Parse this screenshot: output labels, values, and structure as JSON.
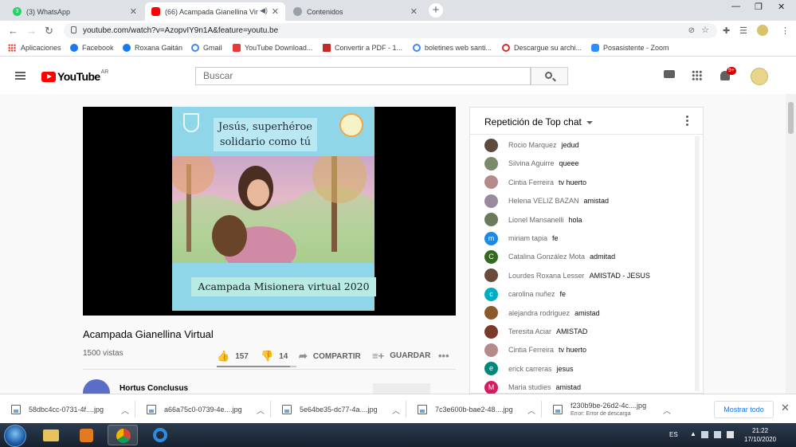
{
  "browser": {
    "tabs": [
      {
        "label": "(3) WhatsApp",
        "favicon_color": "#25d366",
        "favicon_text": "3"
      },
      {
        "label": "(66) Acampada Gianellina Vir",
        "favicon_color": "#ff0000",
        "favicon_text": ""
      },
      {
        "label": "Contenidos",
        "favicon_color": "#9aa0a6",
        "favicon_text": ""
      }
    ],
    "url": "youtube.com/watch?v=AzopvIY9n1A&feature=youtu.be",
    "bookmarks": [
      {
        "label": "Aplicaciones",
        "color": "#ea4335"
      },
      {
        "label": "Facebook",
        "color": "#1877f2"
      },
      {
        "label": "Roxana Gaitán",
        "color": "#1877f2"
      },
      {
        "label": "Gmail",
        "color": "#4285f4"
      },
      {
        "label": "YouTube Download...",
        "color": "#e53935"
      },
      {
        "label": "Convertir a PDF - 1...",
        "color": "#c62828"
      },
      {
        "label": "boletines web santi...",
        "color": "#4285f4"
      },
      {
        "label": "Descargue su archi...",
        "color": "#d32f2f"
      },
      {
        "label": "Posasistente - Zoom",
        "color": "#2d8cff"
      }
    ]
  },
  "youtube": {
    "logo_text": "YouTube",
    "region": "AR",
    "search_placeholder": "Buscar",
    "notifications": "9+",
    "video": {
      "title_overlay_line1": "Jesús, superhéroe",
      "title_overlay_line2": "solidario como tú",
      "caption": "Acampada Misionera virtual 2020",
      "title": "Acampada Gianellina Virtual",
      "views": "1500 vistas",
      "likes": "157",
      "dislikes": "14",
      "like_ratio": 0.918,
      "share_label": "COMPARTIR",
      "save_label": "GUARDAR",
      "channel": "Hortus Conclusus"
    },
    "chat": {
      "title": "Repetición de Top chat",
      "messages": [
        {
          "author": "Rocio Marquez",
          "text": "jedud",
          "avatar_color": "#5d4a3a",
          "initial": ""
        },
        {
          "author": "Silvina Aguirre",
          "text": "queee",
          "avatar_color": "#7a8a6a",
          "initial": ""
        },
        {
          "author": "Cintia Ferreira",
          "text": "tv huerto",
          "avatar_color": "#b58a8a",
          "initial": ""
        },
        {
          "author": "Helena VELIZ BAZAN",
          "text": "amistad",
          "avatar_color": "#9a8aa0",
          "initial": ""
        },
        {
          "author": "Lionel Mansanelli",
          "text": "hola",
          "avatar_color": "#6a7a5a",
          "initial": ""
        },
        {
          "author": "miriam tapia",
          "text": "fe",
          "avatar_color": "#1e88e5",
          "initial": "m"
        },
        {
          "author": "Catalina González Mota",
          "text": "admitad",
          "avatar_color": "#33691e",
          "initial": "C"
        },
        {
          "author": "Lourdes Roxana Lesser",
          "text": "AMISTAD - JESUS",
          "avatar_color": "#6a4a3a",
          "initial": ""
        },
        {
          "author": "carolina nuñez",
          "text": "fe",
          "avatar_color": "#00acc1",
          "initial": "c"
        },
        {
          "author": "alejandra rodriguez",
          "text": "amistad",
          "avatar_color": "#8a5a2a",
          "initial": ""
        },
        {
          "author": "Teresita Aciar",
          "text": "AMISTAD",
          "avatar_color": "#7a3a2a",
          "initial": ""
        },
        {
          "author": "Cintia Ferreira",
          "text": "tv huerto",
          "avatar_color": "#b58a8a",
          "initial": ""
        },
        {
          "author": "erick carreras",
          "text": "jesus",
          "avatar_color": "#00897b",
          "initial": "e"
        },
        {
          "author": "Maria studies",
          "text": "amistad",
          "avatar_color": "#d81b60",
          "initial": "M"
        }
      ]
    }
  },
  "downloads": {
    "items": [
      {
        "name": "58dbc4cc-0731-4f....jpg",
        "error": ""
      },
      {
        "name": "a66a75c0-0739-4e....jpg",
        "error": ""
      },
      {
        "name": "5e64be35-dc77-4a....jpg",
        "error": ""
      },
      {
        "name": "7c3e600b-bae2-48....jpg",
        "error": ""
      },
      {
        "name": "f230b9be-26d2-4c....jpg",
        "error": "Error: Error de descarga"
      }
    ],
    "show_all": "Mostrar todo"
  },
  "taskbar": {
    "language": "ES",
    "time": "21:22",
    "date": "17/10/2020"
  }
}
